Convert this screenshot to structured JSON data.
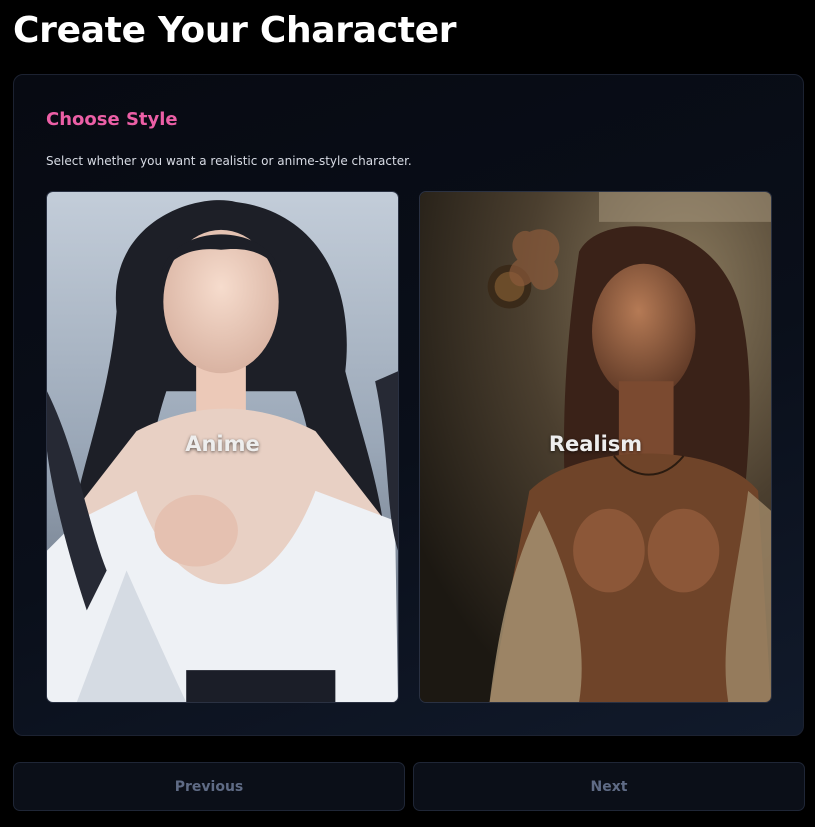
{
  "page": {
    "title": "Create Your Character"
  },
  "step": {
    "title": "Choose Style",
    "description": "Select whether you want a realistic or anime-style character."
  },
  "options": [
    {
      "label": "Anime"
    },
    {
      "label": "Realism"
    }
  ],
  "navigation": {
    "previous_label": "Previous",
    "next_label": "Next"
  },
  "colors": {
    "background": "#000000",
    "panel": "#0a0f1a",
    "accent_pink": "#ec5fa6",
    "button_text_disabled": "#5f6b85"
  }
}
